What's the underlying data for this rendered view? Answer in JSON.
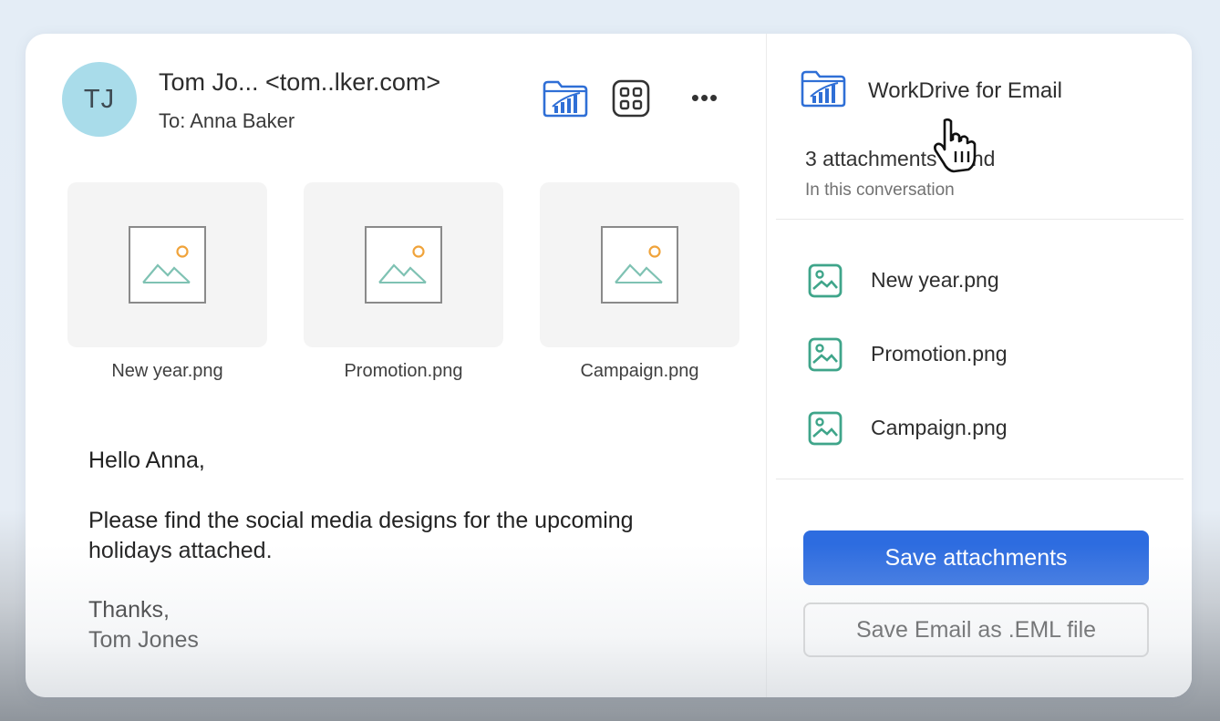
{
  "header": {
    "avatar_initials": "TJ",
    "sender": "Tom Jo... <tom..lker.com>",
    "recipient": "To: Anna Baker"
  },
  "toolbar": {
    "workdrive_icon": "workdrive-folder-icon",
    "apps_icon": "apps-grid-icon",
    "more_label": "•••"
  },
  "attachments_preview": [
    {
      "name": "New year.png"
    },
    {
      "name": "Promotion.png"
    },
    {
      "name": "Campaign.png"
    }
  ],
  "message": {
    "greeting": "Hello Anna,",
    "body_line1": "Please find the social media designs for the upcoming",
    "body_line2": "holidays attached.",
    "closing": "Thanks,",
    "signature": "Tom Jones"
  },
  "panel": {
    "title": "WorkDrive for Email",
    "count_text": "3 attachments found",
    "subtitle": "In this conversation",
    "files": [
      {
        "name": "New year.png"
      },
      {
        "name": "Promotion.png"
      },
      {
        "name": "Campaign.png"
      }
    ],
    "save_attachments_label": "Save attachments",
    "save_eml_label": "Save Email as .EML file"
  },
  "colors": {
    "primary_button": "#2d6ce0",
    "avatar_bg": "#a9dcea",
    "file_icon_green": "#3fa58a",
    "workdrive_blue": "#2f6fd6"
  }
}
